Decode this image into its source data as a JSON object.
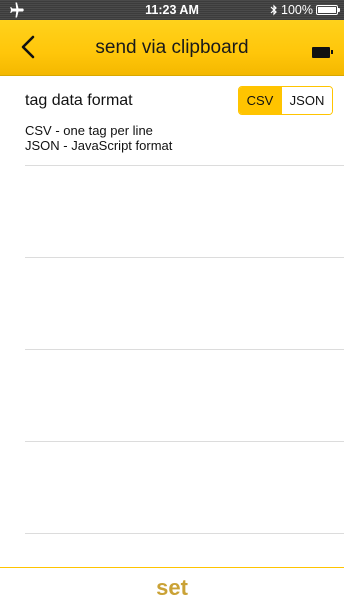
{
  "status_bar": {
    "time": "11:23 AM",
    "battery_percent": "100%",
    "icons": [
      "airplane-icon",
      "bluetooth-icon",
      "battery-icon"
    ]
  },
  "nav": {
    "title": "send via clipboard",
    "back_icon": "chevron-left-icon",
    "right_icon": "battery-icon"
  },
  "setting": {
    "label": "tag data format",
    "options": [
      "CSV",
      "JSON"
    ],
    "selected": "CSV",
    "descriptions": [
      "CSV - one tag per line",
      "JSON - JavaScript format"
    ]
  },
  "footer": {
    "set_label": "set"
  },
  "colors": {
    "accent": "#ffc400",
    "nav_bg": "#ffc60a",
    "set_text": "#caa236"
  }
}
